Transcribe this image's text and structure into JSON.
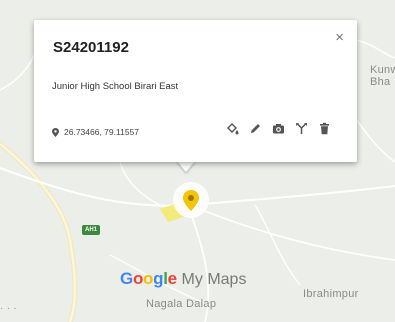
{
  "map": {
    "places": {
      "kunwar": "Kunw\nBha",
      "ibrahimpur": "Ibrahimpur",
      "nagala_dalap": "Nagala Dalap",
      "left_edge": "· ·  ·"
    },
    "road_shield": "AH1",
    "brand": {
      "google": "Google",
      "mymaps": "My Maps"
    },
    "colors": {
      "google_blue": "#4285F4",
      "google_red": "#EA4335",
      "google_yellow": "#FBBC05",
      "google_green": "#34A853",
      "marker": "#f2c40a",
      "highlight": "#f4ec74",
      "road": "#f7f0c8"
    }
  },
  "popup": {
    "title": "S24201192",
    "close_label": "×",
    "description": "Junior High School Birari East",
    "coordinates": "26.73466, 79.11557",
    "tools": [
      "fill-style-icon",
      "edit-icon",
      "camera-icon",
      "directions-icon",
      "delete-icon"
    ]
  }
}
